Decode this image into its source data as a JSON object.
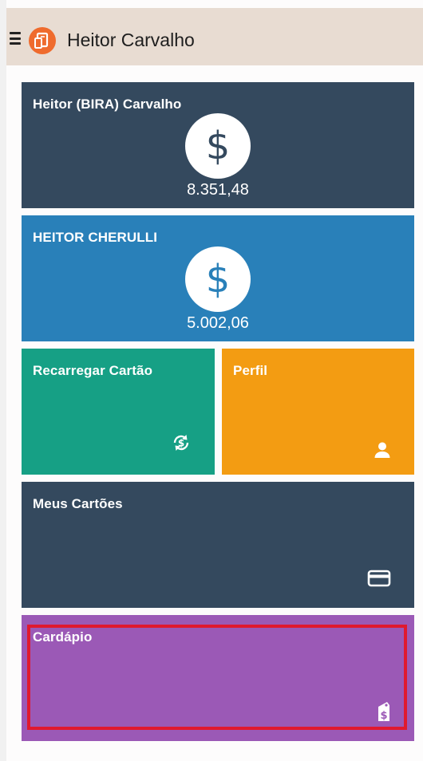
{
  "header": {
    "title": "Heitor Carvalho"
  },
  "icons": {
    "menu": "hamburger-icon",
    "logo": "app-logo-icon",
    "balance": "dollar-icon",
    "recharge": "refresh-dollar-icon",
    "profile": "user-icon",
    "cards": "credit-card-icon",
    "menu_card": "menu-tag-icon"
  },
  "accounts": [
    {
      "name": "Heitor (BIRA) Carvalho",
      "balance": "8.351,48",
      "symbol": "$",
      "color": "#34495e"
    },
    {
      "name": "HEITOR CHERULLI",
      "balance": "5.002,06",
      "symbol": "$",
      "color": "#2980b9"
    }
  ],
  "tiles": {
    "recharge": {
      "label": "Recarregar Cartão",
      "color": "#16a085"
    },
    "profile": {
      "label": "Perfil",
      "color": "#f39c12"
    },
    "cards": {
      "label": "Meus Cartões",
      "color": "#34495e"
    },
    "menu": {
      "label": "Cardápio",
      "color": "#9b59b6"
    }
  },
  "highlight_color": "#e0192f"
}
